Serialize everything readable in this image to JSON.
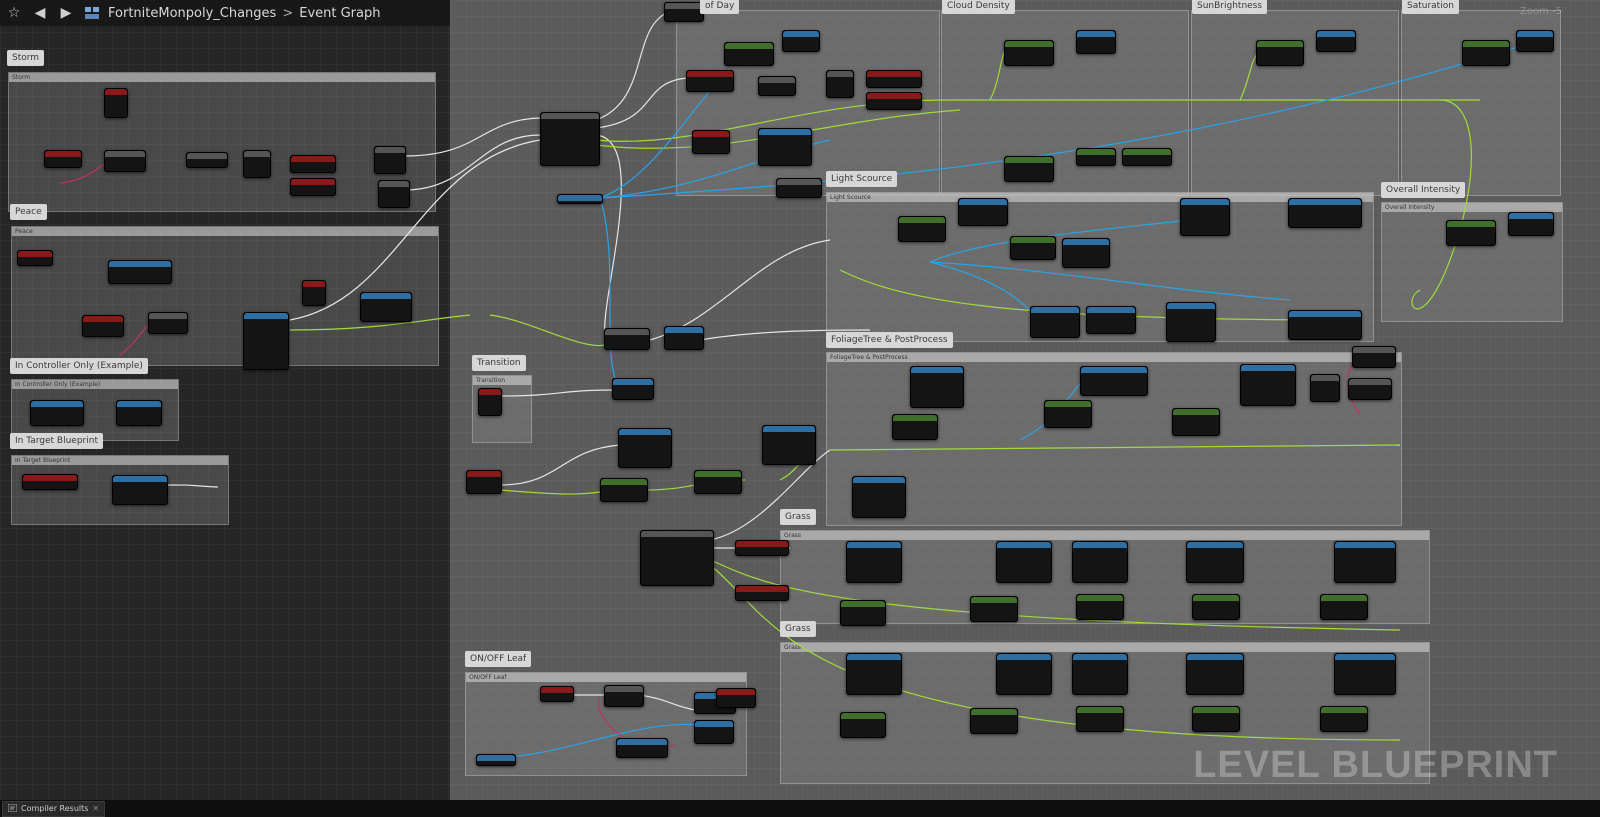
{
  "toolbar": {
    "favorite_icon": "star-icon",
    "back_icon": "arrow-left-icon",
    "forward_icon": "arrow-right-icon",
    "asset_icon": "blueprint-icon",
    "breadcrumb": [
      "FortniteMonpoly_Changes",
      "Event Graph"
    ],
    "separator": ">"
  },
  "comments": {
    "storm": "Storm",
    "peace": "Peace",
    "controller_only": "In Controller Only (Example)",
    "target_blueprint": "In Target Blueprint",
    "transition": "Transition",
    "onoff_leaf": "ON/OFF Leaf",
    "time_of_day": "of Day",
    "cloud_density": "Cloud Density",
    "sun_brightness": "SunBrightness",
    "saturation": "Saturation",
    "light_source": "Light Scource",
    "overall_intensity": "Overall Intensity",
    "foliage": "FoliageTree & PostProcess",
    "grass_1": "Grass",
    "grass_2": "Grass"
  },
  "zoom_label": "Zoom -5",
  "watermark": "LEVEL BLUEPRINT",
  "status": {
    "tab_label": "Compiler Results",
    "close_icon": "close-icon"
  },
  "colors": {
    "event_node": "#8a1a1a",
    "function_node": "#2d6fa3",
    "wire_exec": "#e0e0e0",
    "wire_float": "#9fdc3a",
    "wire_object": "#2aa3e8",
    "wire_struct": "#b0306a"
  }
}
